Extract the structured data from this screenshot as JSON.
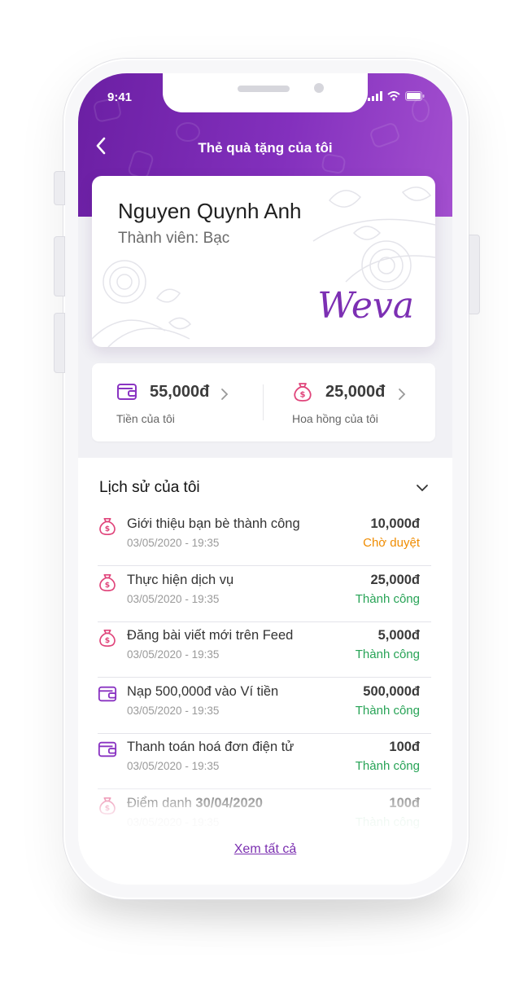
{
  "status_bar": {
    "time": "9:41"
  },
  "header": {
    "title": "Thẻ quà tặng của tôi"
  },
  "card": {
    "name": "Nguyen Quynh Anh",
    "member_label": "Thành viên: Bạc",
    "logo_text": "Weva"
  },
  "wallet": {
    "money": {
      "amount": "55,000đ",
      "label": "Tiền của tôi",
      "icon": "wallet-icon"
    },
    "commission": {
      "amount": "25,000đ",
      "label": "Hoa hồng của tôi",
      "icon": "money-bag-icon"
    }
  },
  "history": {
    "title": "Lịch sử của tôi",
    "see_all": "Xem tất cả",
    "items": [
      {
        "icon": "money-bag-icon",
        "desc": "Giới thiệu bạn bè thành công",
        "date": "03/05/2020 - 19:35",
        "amount": "10,000đ",
        "status": "Chờ duyệt",
        "status_type": "pending"
      },
      {
        "icon": "money-bag-icon",
        "desc": "Thực hiện dịch vụ",
        "date": "03/05/2020 - 19:35",
        "amount": "25,000đ",
        "status": "Thành công",
        "status_type": "success"
      },
      {
        "icon": "money-bag-icon",
        "desc": "Đăng bài viết mới trên Feed",
        "date": "03/05/2020 - 19:35",
        "amount": "5,000đ",
        "status": "Thành công",
        "status_type": "success"
      },
      {
        "icon": "wallet-icon",
        "desc": "Nạp 500,000đ vào Ví tiền",
        "date": "03/05/2020 - 19:35",
        "amount": "500,000đ",
        "status": "Thành công",
        "status_type": "success"
      },
      {
        "icon": "wallet-icon",
        "desc": "Thanh toán hoá đơn điện tử",
        "date": "03/05/2020 - 19:35",
        "amount": "100đ",
        "status": "Thành công",
        "status_type": "success"
      },
      {
        "icon": "money-bag-icon",
        "desc_prefix": "Điểm danh ",
        "desc_bold": "30/04/2020",
        "date": "03/05/2020 - 19:35",
        "amount": "100đ",
        "status": "Thành công",
        "status_type": "success"
      }
    ]
  },
  "colors": {
    "brand_purple": "#7c2fb3",
    "pink_icon": "#e0457b",
    "pending": "#f08c00",
    "success": "#27a356"
  }
}
